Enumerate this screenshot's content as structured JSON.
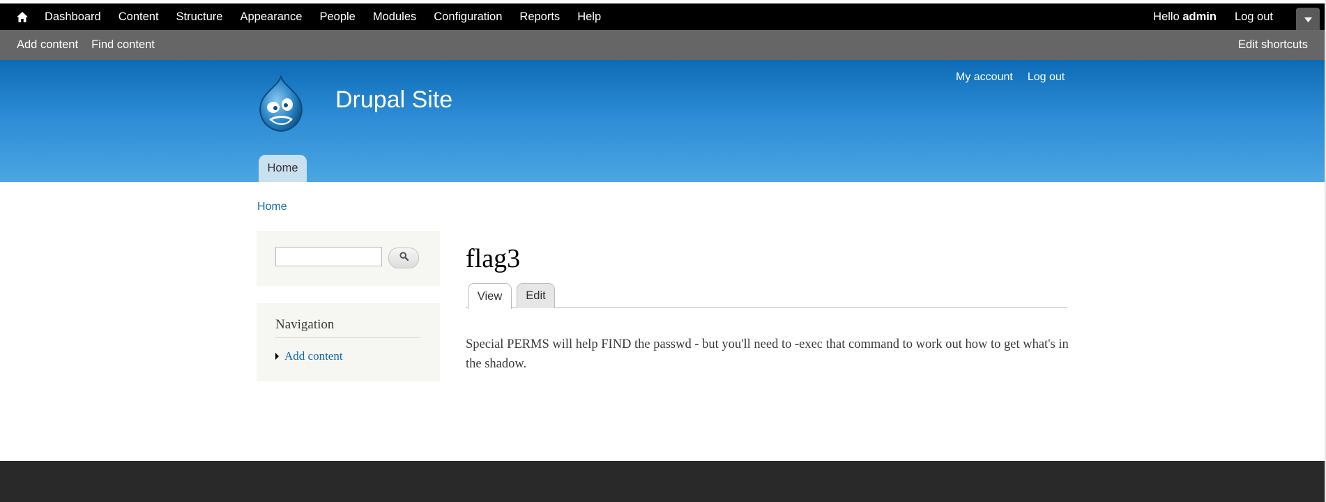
{
  "toolbar": {
    "menu": [
      "Dashboard",
      "Content",
      "Structure",
      "Appearance",
      "People",
      "Modules",
      "Configuration",
      "Reports",
      "Help"
    ],
    "hello_prefix": "Hello ",
    "username": "admin",
    "logout": "Log out"
  },
  "shortcuts": {
    "links": [
      "Add content",
      "Find content"
    ],
    "edit": "Edit shortcuts"
  },
  "header": {
    "site_name": "Drupal Site",
    "secondary_menu": [
      "My account",
      "Log out"
    ],
    "main_menu": [
      "Home"
    ]
  },
  "breadcrumb": "Home",
  "sidebar": {
    "search": {
      "value": ""
    },
    "navigation": {
      "title": "Navigation",
      "items": [
        "Add content"
      ]
    }
  },
  "content": {
    "title": "flag3",
    "tabs": [
      "View",
      "Edit"
    ],
    "body": "Special PERMS will help FIND the passwd - but you'll need to -exec that command to work out how to get what's in the shadow."
  },
  "colors": {
    "toolbar": "#000000",
    "shortcuts_bar": "#666666",
    "header_top": "#0c6bb4",
    "header_bottom": "#4ba6e2",
    "link": "#0a6ab3",
    "footer": "#292929"
  }
}
